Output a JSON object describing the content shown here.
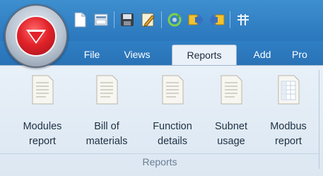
{
  "tabs": [
    {
      "label": "File",
      "active": false
    },
    {
      "label": "Views",
      "active": false
    },
    {
      "label": "Reports",
      "active": true
    },
    {
      "label": "Add",
      "active": false
    },
    {
      "label": "Pro",
      "active": false
    }
  ],
  "quick_access": [
    {
      "icon": "new-document-icon"
    },
    {
      "icon": "open-icon"
    },
    {
      "icon": "save-icon"
    },
    {
      "icon": "edit-icon"
    },
    {
      "icon": "refresh-icon"
    },
    {
      "icon": "export-icon"
    },
    {
      "icon": "import-icon"
    },
    {
      "icon": "network-icon"
    }
  ],
  "ribbon": {
    "group_label": "Reports",
    "buttons": [
      {
        "line1": "Modules",
        "line2": "report",
        "icon": "report-document-icon"
      },
      {
        "line1": "Bill of",
        "line2": "materials",
        "icon": "report-document-icon"
      },
      {
        "line1": "Function",
        "line2": "details",
        "icon": "report-document-icon"
      },
      {
        "line1": "Subnet",
        "line2": "usage",
        "icon": "report-document-icon"
      },
      {
        "line1": "Modbus",
        "line2": "report",
        "icon": "table-document-icon"
      }
    ]
  },
  "colors": {
    "titlebar": "#2f7fc5",
    "ribbon": "#e3ecf6",
    "brand_red": "#e2232a"
  }
}
